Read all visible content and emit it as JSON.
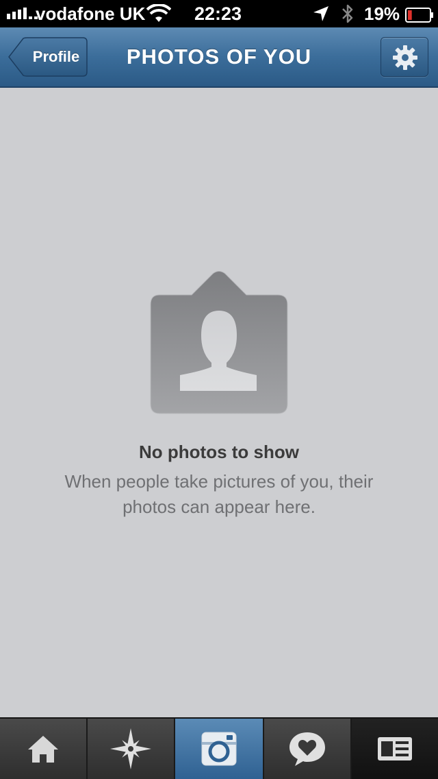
{
  "status_bar": {
    "carrier": "vodafone UK",
    "time": "22:23",
    "battery_percent": "19%",
    "signal_icon": "signal-bars-icon",
    "wifi_icon": "wifi-icon",
    "location_icon": "location-arrow-icon",
    "bluetooth_icon": "bluetooth-icon",
    "battery_icon": "battery-icon",
    "battery_level": 0.19,
    "battery_color": "#e0312b"
  },
  "nav_bar": {
    "back_label": "Profile",
    "title": "PHOTOS OF YOU",
    "settings_icon": "gear-icon",
    "color": "#3b6d9a"
  },
  "empty_state": {
    "icon": "person-placeholder-icon",
    "title": "No photos to show",
    "description": "When people take pictures of you, their photos can appear here."
  },
  "tab_bar": {
    "tabs": [
      {
        "icon": "home-icon",
        "selected": false
      },
      {
        "icon": "explore-star-icon",
        "selected": false
      },
      {
        "icon": "camera-icon",
        "selected": true
      },
      {
        "icon": "activity-heart-bubble-icon",
        "selected": false
      },
      {
        "icon": "news-profile-icon",
        "selected": false
      }
    ],
    "selected_color": "#3b6d9a"
  }
}
